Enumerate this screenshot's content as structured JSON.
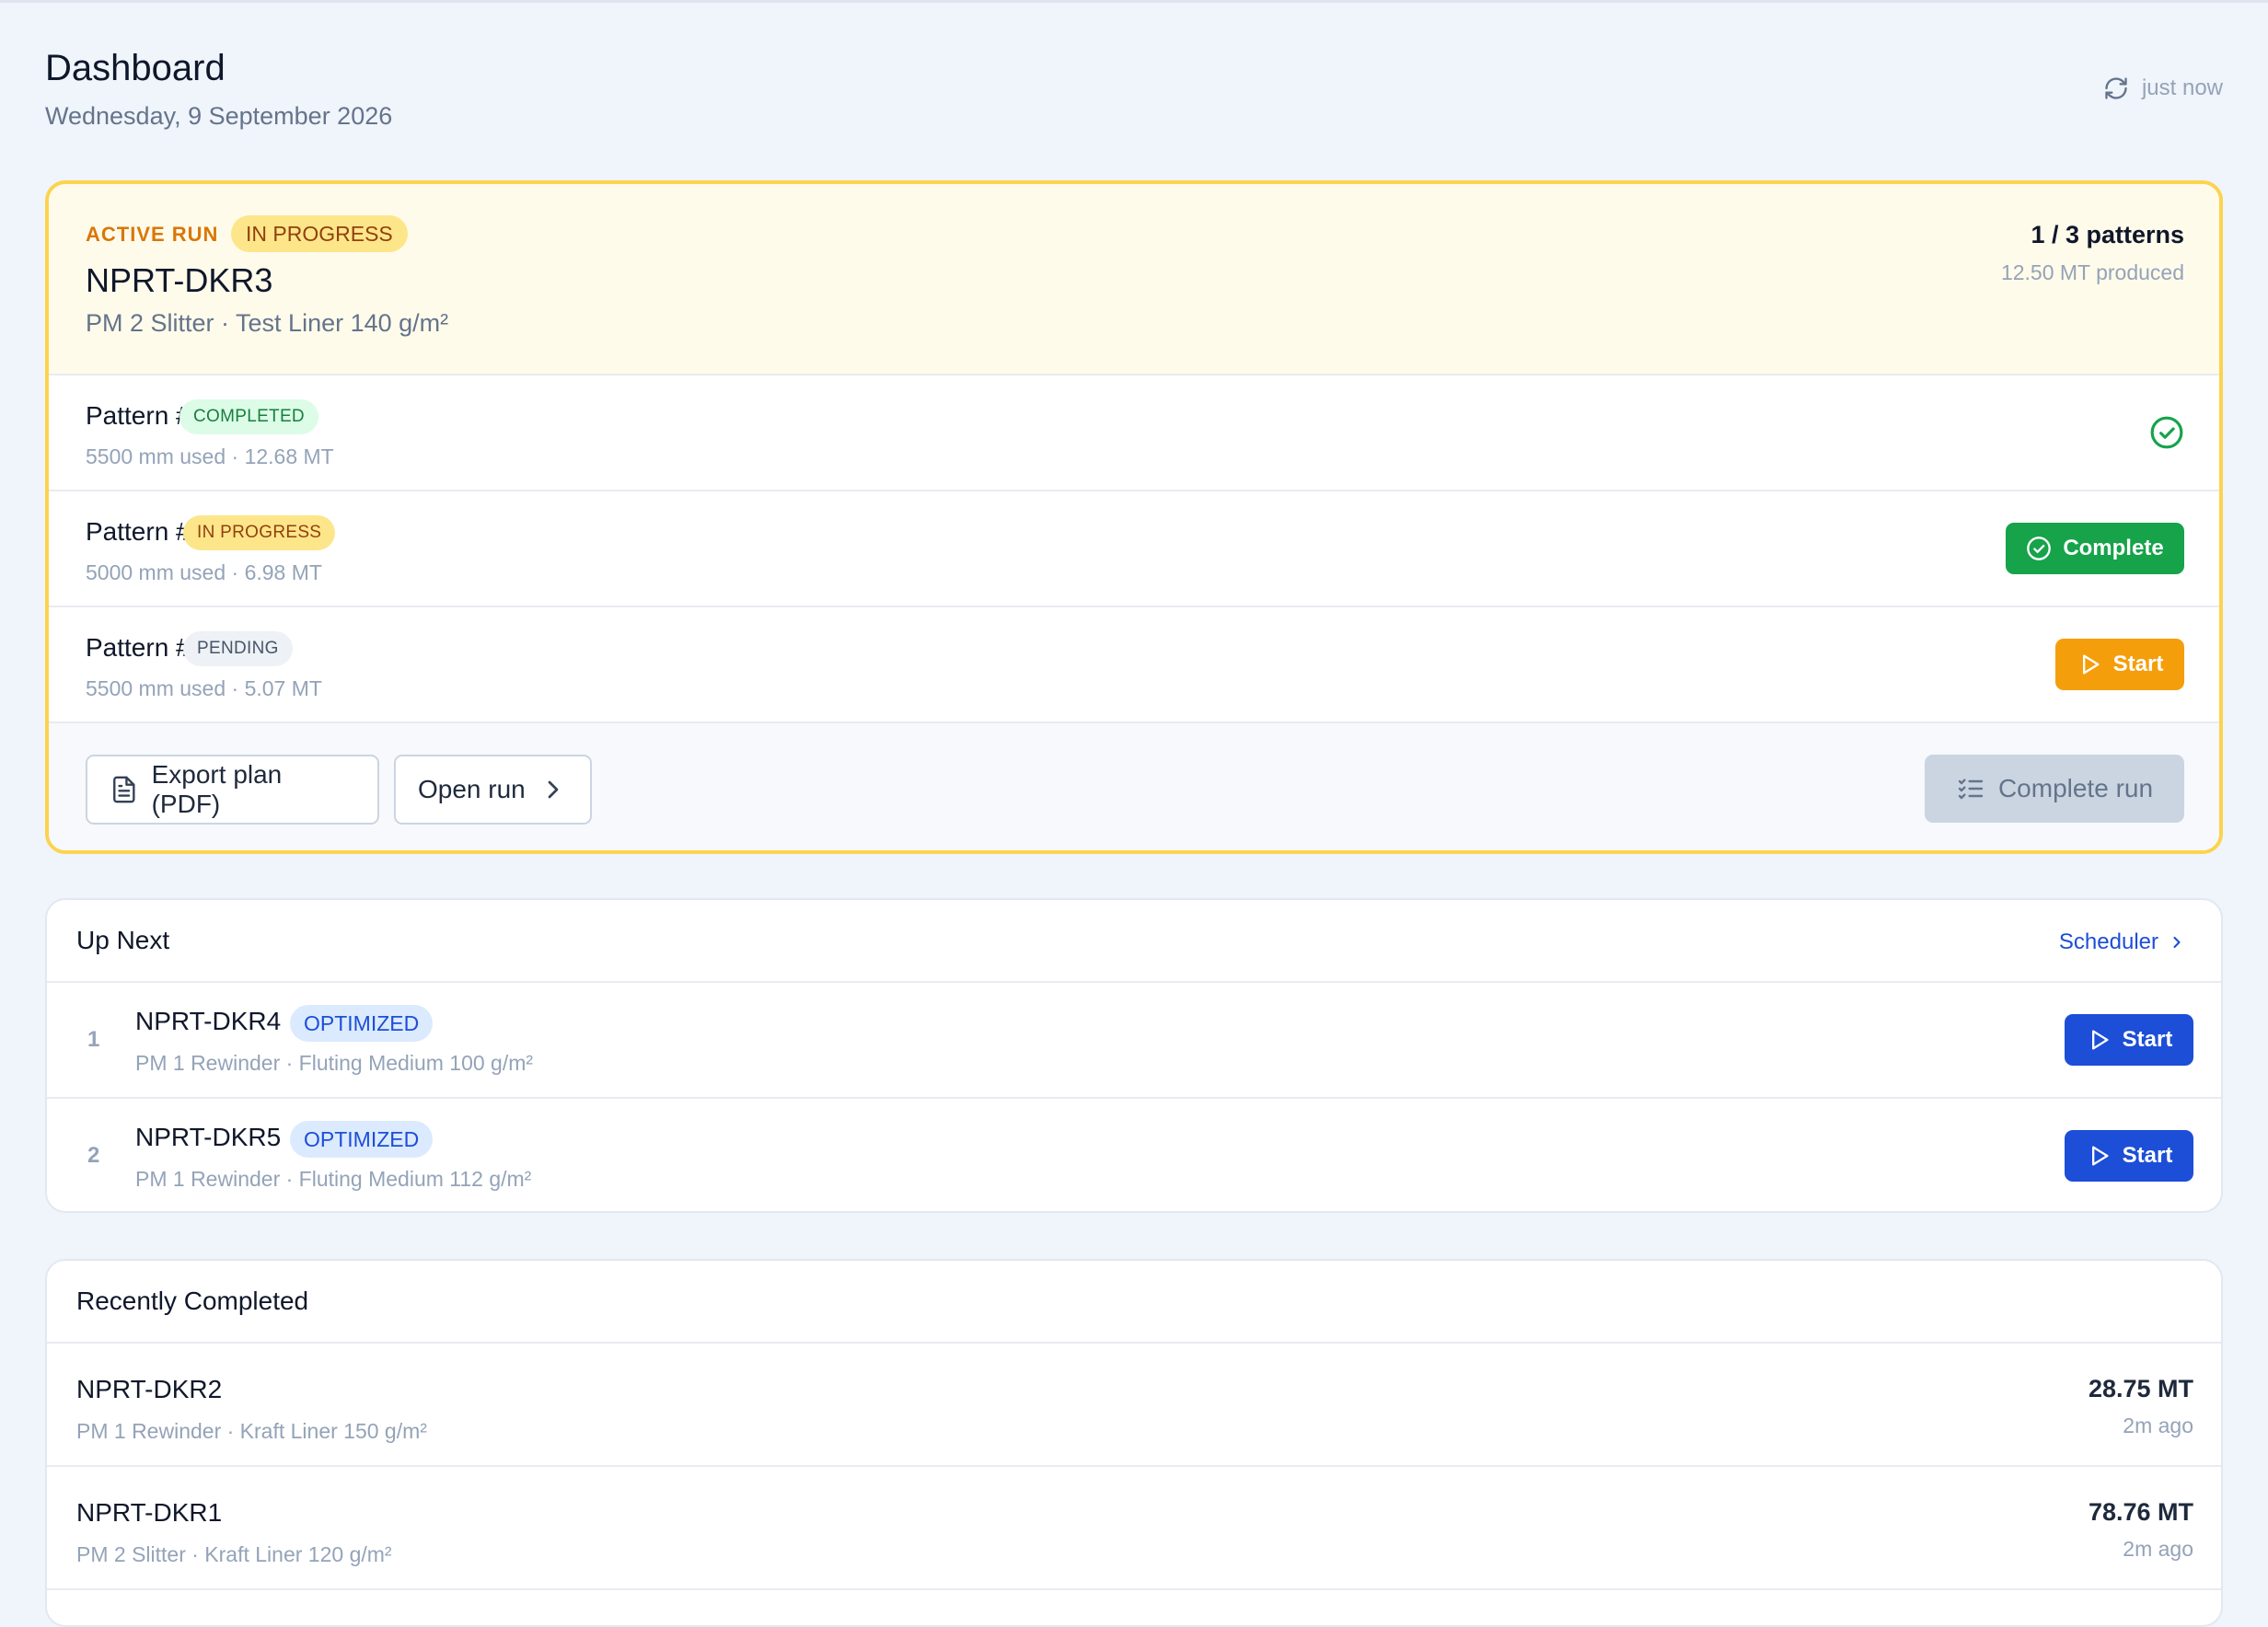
{
  "header": {
    "title": "Dashboard",
    "date": "Wednesday, 9 September 2026",
    "refresh_label": "just now"
  },
  "active_run": {
    "label": "ACTIVE RUN",
    "status": "IN PROGRESS",
    "name": "NPRT-DKR3",
    "subtitle": "PM 2 Slitter · Test Liner 140 g/m²",
    "patterns_summary": "1 / 3 patterns",
    "produced": "12.50 MT produced",
    "patterns": [
      {
        "name": "Pattern #1",
        "status": "COMPLETED",
        "meta": "5500 mm used · 12.68 MT"
      },
      {
        "name": "Pattern #2",
        "status": "IN PROGRESS",
        "meta": "5000 mm used · 6.98 MT",
        "action": "Complete"
      },
      {
        "name": "Pattern #3",
        "status": "PENDING",
        "meta": "5500 mm used · 5.07 MT",
        "action": "Start"
      }
    ],
    "actions": {
      "export": "Export plan (PDF)",
      "open": "Open run",
      "complete_run": "Complete run"
    }
  },
  "up_next": {
    "title": "Up Next",
    "link": "Scheduler",
    "items": [
      {
        "num": "1",
        "name": "NPRT-DKR4",
        "status": "OPTIMIZED",
        "meta": "PM 1 Rewinder · Fluting Medium 100 g/m²",
        "action": "Start"
      },
      {
        "num": "2",
        "name": "NPRT-DKR5",
        "status": "OPTIMIZED",
        "meta": "PM 1 Rewinder · Fluting Medium 112 g/m²",
        "action": "Start"
      }
    ]
  },
  "recently_completed": {
    "title": "Recently Completed",
    "items": [
      {
        "name": "NPRT-DKR2",
        "meta": "PM 1 Rewinder · Kraft Liner 150 g/m²",
        "value": "28.75 MT",
        "ago": "2m ago"
      },
      {
        "name": "NPRT-DKR1",
        "meta": "PM 2 Slitter · Kraft Liner 120 g/m²",
        "value": "78.76 MT",
        "ago": "2m ago"
      }
    ]
  },
  "colors": {
    "accent_blue": "#1d4ed8",
    "success_green": "#16a34a",
    "warning_orange": "#f59e0b",
    "active_border": "#fcd34d"
  }
}
